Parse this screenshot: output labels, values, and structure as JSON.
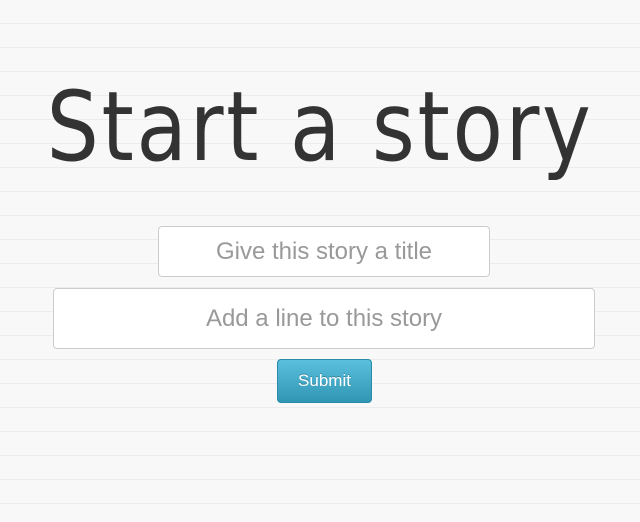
{
  "heading": {
    "text": "Start a story"
  },
  "form": {
    "title_placeholder": "Give this story a title",
    "line_placeholder": "Add a line to this story",
    "title_value": "",
    "line_value": "",
    "submit_label": "Submit"
  },
  "colors": {
    "heading": "#333333",
    "button_top": "#5bc0de",
    "button_bottom": "#2f96b4",
    "background": "#f7f7f7"
  }
}
